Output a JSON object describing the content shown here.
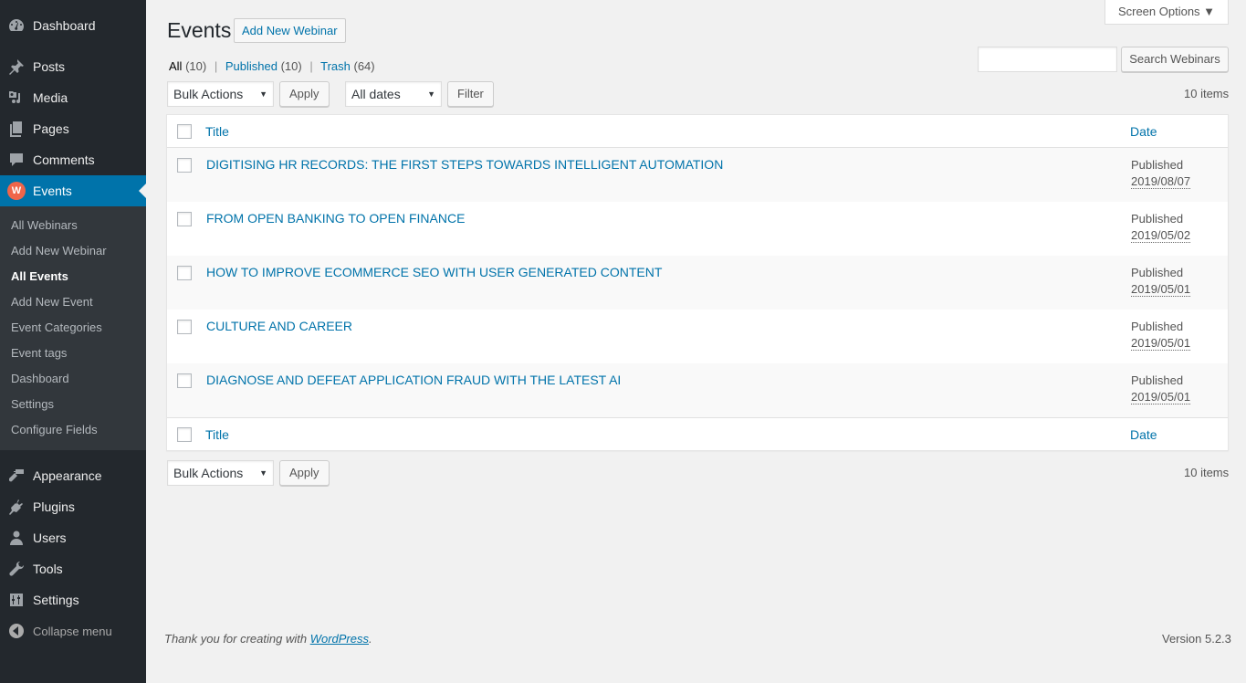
{
  "sidebar": {
    "items": [
      {
        "label": "Dashboard",
        "icon": "dashboard-icon"
      },
      {
        "label": "Posts",
        "icon": "pushpin-icon"
      },
      {
        "label": "Media",
        "icon": "media-icon"
      },
      {
        "label": "Pages",
        "icon": "pages-icon"
      },
      {
        "label": "Comments",
        "icon": "comment-icon"
      },
      {
        "label": "Events",
        "icon": "events-badge-icon",
        "badge_letter": "W",
        "badge_color": "#f0654a"
      },
      {
        "label": "Appearance",
        "icon": "paintbrush-icon"
      },
      {
        "label": "Plugins",
        "icon": "plug-icon"
      },
      {
        "label": "Users",
        "icon": "user-icon"
      },
      {
        "label": "Tools",
        "icon": "wrench-icon"
      },
      {
        "label": "Settings",
        "icon": "sliders-icon"
      }
    ],
    "submenu": [
      {
        "label": "All Webinars"
      },
      {
        "label": "Add New Webinar"
      },
      {
        "label": "All Events",
        "current": true
      },
      {
        "label": "Add New Event"
      },
      {
        "label": "Event Categories"
      },
      {
        "label": "Event tags"
      },
      {
        "label": "Dashboard"
      },
      {
        "label": "Settings"
      },
      {
        "label": "Configure Fields"
      }
    ],
    "collapse_label": "Collapse menu",
    "active_color": "#0073aa"
  },
  "header": {
    "title": "Events",
    "add_new_label": "Add New Webinar",
    "screen_options_label": "Screen Options ▼"
  },
  "views": {
    "all_label": "All",
    "all_count": "(10)",
    "published_label": "Published",
    "published_count": "(10)",
    "trash_label": "Trash",
    "trash_count": "(64)",
    "separator": "|"
  },
  "search": {
    "value": "",
    "button_label": "Search Webinars"
  },
  "tablenav_top": {
    "bulk_actions": "Bulk Actions",
    "apply_label": "Apply",
    "date_filter": "All dates",
    "filter_label": "Filter",
    "items_count": "10 items"
  },
  "table": {
    "columns": {
      "title": "Title",
      "date": "Date"
    },
    "rows": [
      {
        "title": "DIGITISING HR RECORDS: THE FIRST STEPS TOWARDS INTELLIGENT AUTOMATION",
        "status": "Published",
        "date": "2019/08/07"
      },
      {
        "title": "FROM OPEN BANKING TO OPEN FINANCE",
        "status": "Published",
        "date": "2019/05/02"
      },
      {
        "title": "HOW TO IMPROVE ECOMMERCE SEO WITH USER GENERATED CONTENT",
        "status": "Published",
        "date": "2019/05/01"
      },
      {
        "title": "CULTURE AND CAREER",
        "status": "Published",
        "date": "2019/05/01"
      },
      {
        "title": "DIAGNOSE AND DEFEAT APPLICATION FRAUD WITH THE LATEST AI",
        "status": "Published",
        "date": "2019/05/01"
      }
    ]
  },
  "tablenav_bottom": {
    "bulk_actions": "Bulk Actions",
    "apply_label": "Apply",
    "items_count": "10 items"
  },
  "footer": {
    "thanks_prefix": "Thank you for creating with ",
    "wordpress_link": "WordPress",
    "thanks_suffix": ".",
    "version": "Version 5.2.3"
  }
}
